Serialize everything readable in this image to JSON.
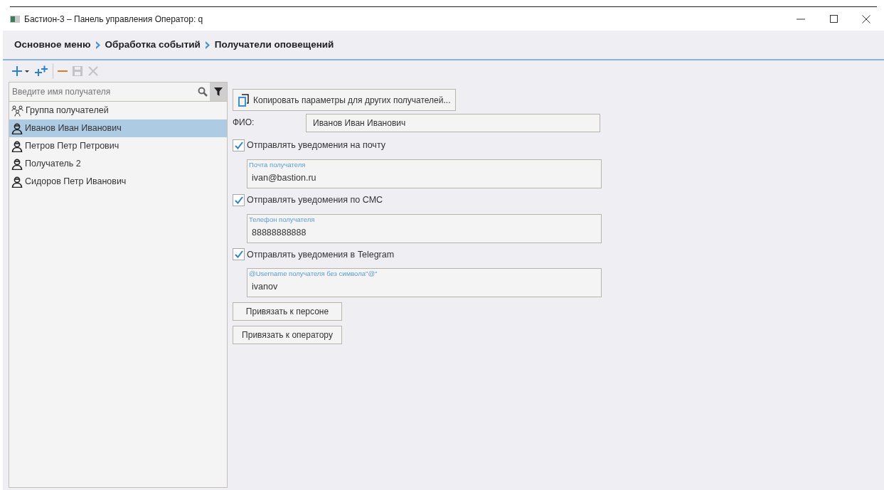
{
  "window": {
    "title": "Бастион-3 – Панель управления Оператор: q"
  },
  "breadcrumb": [
    "Основное меню",
    "Обработка событий",
    "Получатели оповещений"
  ],
  "toolbar": [
    {
      "kind": "add",
      "disabled": false
    },
    {
      "kind": "add-multi",
      "disabled": false
    },
    {
      "kind": "remove",
      "disabled": false
    },
    {
      "kind": "save",
      "disabled": true
    },
    {
      "kind": "cancel",
      "disabled": true
    }
  ],
  "search": {
    "placeholder": "Введите имя получателя"
  },
  "recipients": [
    {
      "name": "Группа получателей",
      "kind": "group",
      "selected": false
    },
    {
      "name": "Иванов Иван Иванович",
      "kind": "person",
      "selected": true
    },
    {
      "name": "Петров Петр Петрович",
      "kind": "person",
      "selected": false
    },
    {
      "name": "Получатель 2",
      "kind": "person",
      "selected": false
    },
    {
      "name": "Сидоров Петр Иванович",
      "kind": "person",
      "selected": false
    }
  ],
  "form": {
    "copy_button": "Копировать параметры для других получателей...",
    "name_label": "ФИО:",
    "name_value": "Иванов Иван Иванович",
    "channels": [
      {
        "label": "Отправлять уведомения на почту",
        "checked": true,
        "field_label": "Почта получателя",
        "value": "ivan@bastion.ru"
      },
      {
        "label": "Отправлять уведомения по СМС",
        "checked": true,
        "field_label": "Телефон получателя",
        "value": "88888888888"
      },
      {
        "label": "Отправлять уведомения в Telegram",
        "checked": true,
        "field_label": "@Username получателя без символа\"@\"",
        "value": "ivanov"
      }
    ],
    "buttons": [
      "Привязать к персоне",
      "Привязать к оператору"
    ]
  }
}
